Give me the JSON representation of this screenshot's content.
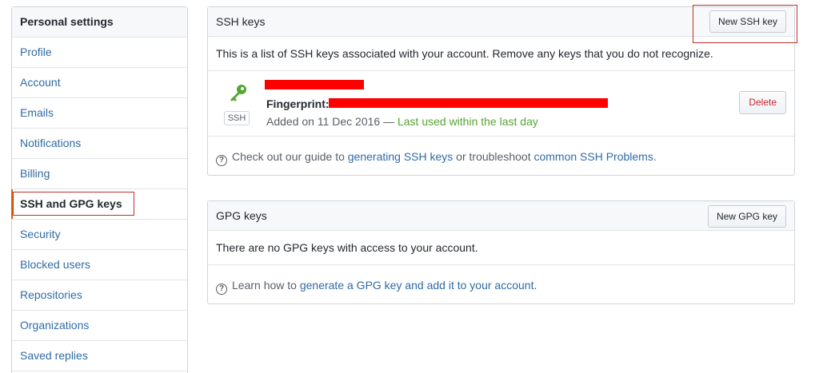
{
  "sidebar": {
    "header": "Personal settings",
    "items": [
      {
        "label": "Profile"
      },
      {
        "label": "Account"
      },
      {
        "label": "Emails"
      },
      {
        "label": "Notifications"
      },
      {
        "label": "Billing"
      },
      {
        "label": "SSH and GPG keys",
        "selected": true
      },
      {
        "label": "Security"
      },
      {
        "label": "Blocked users"
      },
      {
        "label": "Repositories"
      },
      {
        "label": "Organizations"
      },
      {
        "label": "Saved replies"
      }
    ]
  },
  "ssh": {
    "title": "SSH keys",
    "new_button": "New SSH key",
    "description": "This is a list of SSH keys associated with your account. Remove any keys that you do not recognize.",
    "key": {
      "icon": "key-icon",
      "badge": "SSH",
      "fingerprint_label": "Fingerprint:",
      "added_prefix": "Added on 11 Dec 2016 — ",
      "last_used": "Last used within the last day",
      "delete_button": "Delete"
    },
    "help": {
      "prefix": "Check out our guide to ",
      "link1": "generating SSH keys",
      "middle": " or troubleshoot ",
      "link2": "common SSH Problems",
      "suffix": "."
    }
  },
  "gpg": {
    "title": "GPG keys",
    "new_button": "New GPG key",
    "empty": "There are no GPG keys with access to your account.",
    "help": {
      "prefix": "Learn how to ",
      "link": "generate a GPG key and add it to your account",
      "suffix": "."
    }
  },
  "colors": {
    "link": "#2f6ba5",
    "green": "#55a532",
    "annotation_outline": "#c0302a",
    "redaction": "#ff0000"
  }
}
